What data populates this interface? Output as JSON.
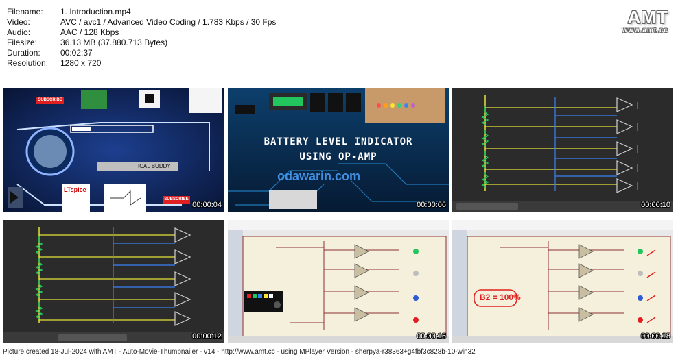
{
  "info": [
    {
      "key": "Filename:",
      "value": "1. Introduction.mp4"
    },
    {
      "key": "Video:",
      "value": "AVC / avc1 / Advanced Video Coding / 1.783 Kbps / 30 Fps"
    },
    {
      "key": "Audio:",
      "value": "AAC / 128 Kbps"
    },
    {
      "key": "Filesize:",
      "value": "36.13 MB (37.880.713 Bytes)"
    },
    {
      "key": "Duration:",
      "value": "00:02:37"
    },
    {
      "key": "Resolution:",
      "value": "1280 x 720"
    }
  ],
  "logo": {
    "big": "AMT",
    "small": "www.amt.cc"
  },
  "thumbs": [
    {
      "time": "00:00:04",
      "subscribe": "SUBSCRIBE",
      "buddy": "ICAL BUDDY",
      "ltspice": "LTspice"
    },
    {
      "time": "00:00:06",
      "title1": "BATTERY LEVEL INDICATOR",
      "title2": "USING OP-AMP",
      "brand": "odawarin.com"
    },
    {
      "time": "00:00:10"
    },
    {
      "time": "00:00:12"
    },
    {
      "time": "00:00:16"
    },
    {
      "time": "00:00:18",
      "note": "B2 = 100%"
    }
  ],
  "footer": "Picture created 18-Jul-2024 with AMT - Auto-Movie-Thumbnailer - v14 - http://www.amt.cc - using MPlayer Version - sherpya-r38363+g4fbf3c828b-10-win32",
  "colors": {
    "board": "#2b2b2b",
    "yellow": "#e8e23a",
    "green": "#22c55e",
    "blue": "#3b82f6",
    "red": "#ff3b30",
    "schematic": "#f5f0dc"
  }
}
